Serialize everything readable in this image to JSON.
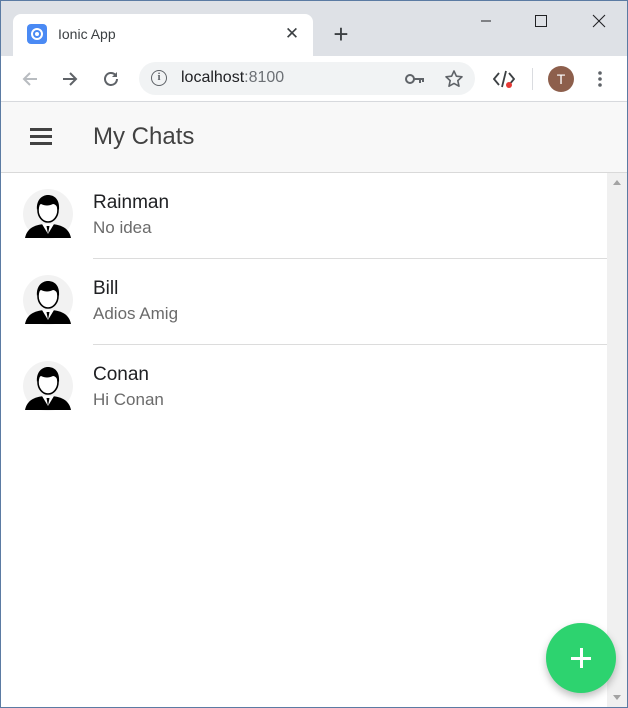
{
  "browser": {
    "tab": {
      "title": "Ionic App",
      "favicon": "ionic-logo-icon"
    },
    "address": {
      "host": "localhost",
      "port": ":8100"
    },
    "profile_initial": "T",
    "colors": {
      "tabstrip": "#dee1e6",
      "profile": "#8d5f4c"
    }
  },
  "app": {
    "title": "My Chats",
    "chats": [
      {
        "name": "Rainman",
        "last_message": "No idea"
      },
      {
        "name": "Bill",
        "last_message": "Adios Amig"
      },
      {
        "name": "Conan",
        "last_message": "Hi Conan"
      }
    ],
    "fab": {
      "icon": "add-icon",
      "color": "#2dd36f"
    }
  }
}
